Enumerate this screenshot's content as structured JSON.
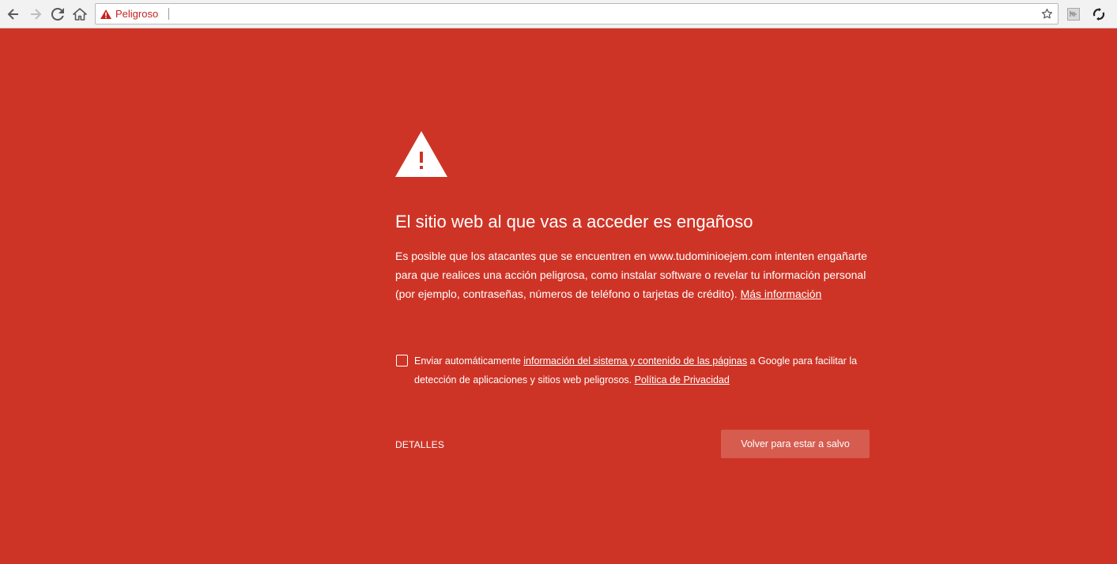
{
  "browser": {
    "security_label": "Peligroso",
    "url": "",
    "icons": {
      "back": "back-arrow-icon",
      "forward": "forward-arrow-icon",
      "reload": "reload-icon",
      "home": "home-icon",
      "warning": "warning-triangle-icon",
      "bookmark": "star-icon",
      "extension_1": "extension-icon",
      "extension_2": "sync-icon"
    }
  },
  "interstitial": {
    "background_color": "#ce3426",
    "icon": "warning-triangle-icon",
    "heading": "El sitio web al que vas a acceder es engañoso",
    "body_part1": "Es posible que los atacantes que se encuentren en ",
    "body_domain": "www.tudominioejem.com",
    "body_part2": " intenten engañarte para que realices una acción peligrosa, como instalar software o revelar tu información personal (por ejemplo, contraseñas, números de teléfono o tarjetas de crédito). ",
    "more_info_link": "Más información",
    "optin": {
      "checked": false,
      "text_before": "Enviar automáticamente ",
      "link": "información del sistema y contenido de las páginas",
      "text_after": " a Google para facilitar la detección de aplicaciones y sitios web peligrosos. ",
      "privacy_link": "Política de Privacidad"
    },
    "details_button": "DETALLES",
    "primary_button": "Volver para estar a salvo"
  }
}
